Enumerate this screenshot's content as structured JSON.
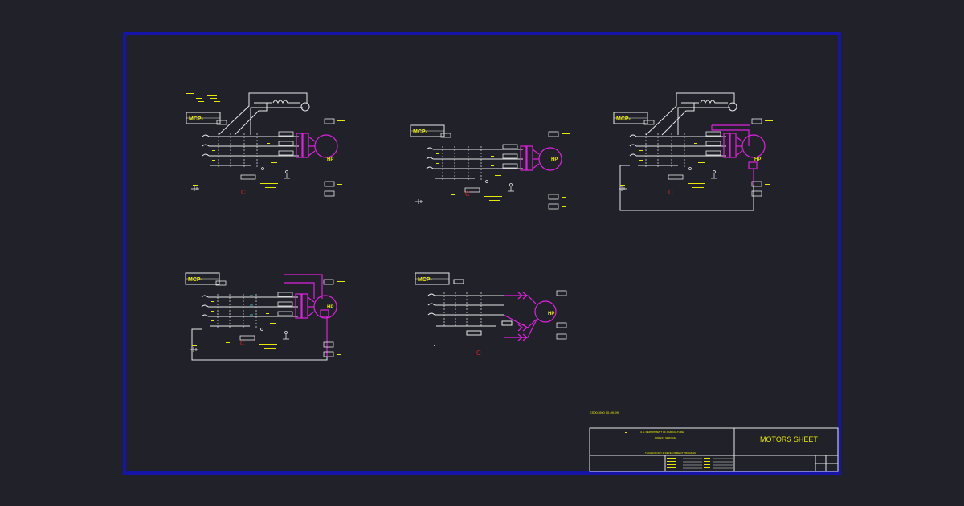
{
  "drawing": {
    "sheet_title": "MOTORS SHEET",
    "agency_line1": "U.S. DEPARTMENT OF AGRICULTURE",
    "agency_line2": "FOREST SERVICE",
    "subtitle": "TECHNOLOGY & DEVELOPMENT PROGRAM",
    "drawing_id": "ES001000  10-09-99"
  },
  "labels": {
    "mcp": "MCP-",
    "motor": "HP",
    "contactor": "C"
  },
  "colors": {
    "background": "#212229",
    "frame": "#1515a8",
    "wiring": "#e8e8e8",
    "labels": "#e8e800",
    "motor": "#e020e0",
    "control": "#e02020"
  }
}
